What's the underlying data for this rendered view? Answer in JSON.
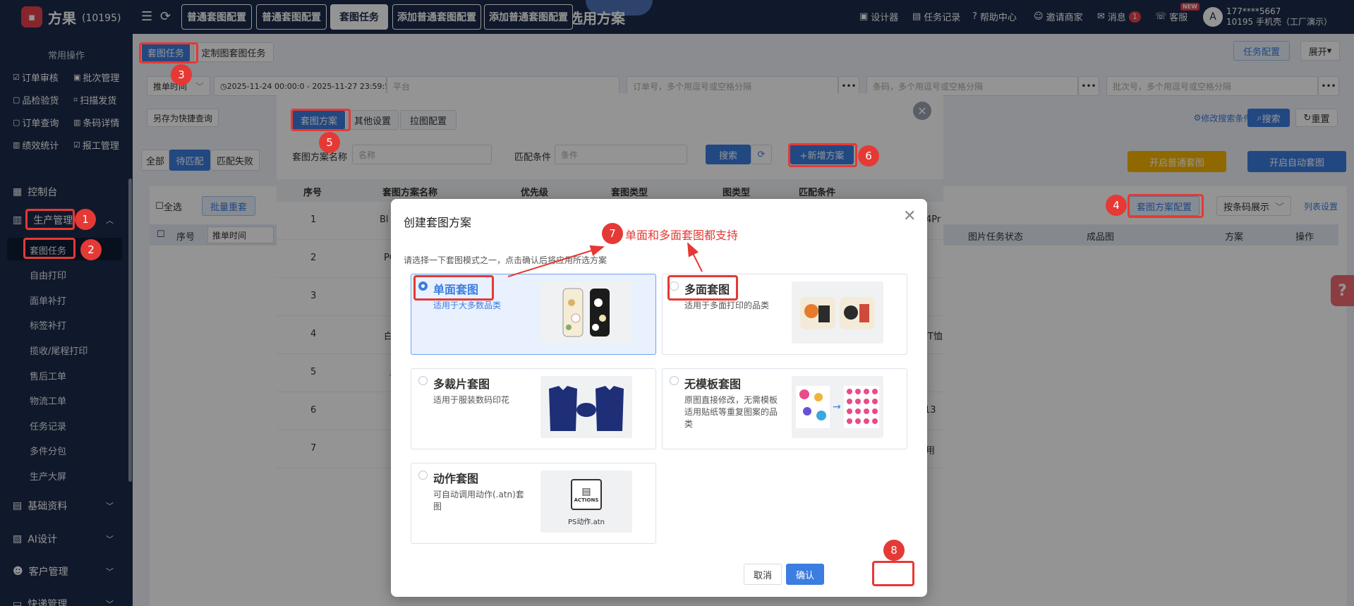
{
  "brand": {
    "name": "方果",
    "id": "(10195)"
  },
  "top_tabs": [
    "普通套图配置",
    "普通套图配置",
    "套图任务",
    "添加普通套图配置",
    "添加普通套图配置"
  ],
  "page_title": "选用方案",
  "top_links": {
    "designer": "设计器",
    "task_log": "任务记录",
    "help": "帮助中心",
    "invite": "邀请商家",
    "message": "消息",
    "message_count": "1",
    "service": "客服",
    "new": "NEW"
  },
  "user": {
    "phone": "177****5667",
    "name": "10195 手机壳（工厂演示）"
  },
  "sidebar": {
    "quick_title": "常用操作",
    "quick_ops": [
      "订单审核",
      "批次管理",
      "品检验货",
      "扫描发货",
      "订单查询",
      "条码详情",
      "绩效统计",
      "报工管理"
    ],
    "console": "控制台",
    "production": "生产管理",
    "sub_items": [
      "套图任务",
      "自由打印",
      "面单补打",
      "标签补打",
      "揽收/尾程打印",
      "售后工单",
      "物流工单",
      "任务记录",
      "多件分包",
      "生产大屏"
    ],
    "basic": "基础资料",
    "ai": "AI设计",
    "customer": "客户管理",
    "express": "快递管理"
  },
  "tabs": {
    "task": "套图任务",
    "custom": "定制图套图任务"
  },
  "right_btns": {
    "config": "任务配置",
    "expand": "展开"
  },
  "filters": {
    "time_type": "推单时间",
    "date_range": "2025-11-24 00:00:0 - 2025-11-27 23:59:5",
    "platform": "平台",
    "order": "订单号，多个用逗号或空格分隔",
    "barcode": "条码，多个用逗号或空格分隔",
    "batch": "批次号，多个用逗号或空格分隔",
    "more": "•••",
    "save_quick": "另存为快捷查询",
    "edit_conditions": "修改搜索条件",
    "search": "搜索",
    "reset": "重置"
  },
  "status_tabs": [
    "全部",
    "待匹配",
    "匹配失败"
  ],
  "actions": {
    "start_normal": "开启普通套图",
    "start_auto": "开启自动套图",
    "select_all": "全选",
    "batch_redo": "批量重套",
    "scheme_config": "套图方案配置",
    "display_by": "按条码展示",
    "list_settings": "列表设置"
  },
  "main_columns": {
    "index": "序号",
    "push_time": "推单时间",
    "status": "图片任务状态",
    "product": "成品图",
    "scheme": "方案",
    "ops": "操作"
  },
  "mid_modal": {
    "tabs": [
      "套图方案",
      "其他设置",
      "拉图配置"
    ],
    "name_label": "套图方案名称",
    "name_placeholder": "名称",
    "match_label": "匹配条件",
    "match_placeholder": "条件",
    "search": "搜索",
    "add": "+新增方案",
    "columns": [
      "序号",
      "套图方案名称",
      "优先级",
      "套图类型",
      "图类型",
      "匹配条件"
    ],
    "rows": [
      {
        "index": "1",
        "name": "Bl",
        "right": "4Pr"
      },
      {
        "index": "2",
        "name": "PC",
        "right": ""
      },
      {
        "index": "3",
        "name": "",
        "right": ""
      },
      {
        "index": "4",
        "name": "白",
        "right": "七T恤"
      },
      {
        "index": "5",
        "name": "手",
        "right": ""
      },
      {
        "index": "6",
        "name": "",
        "right": "13"
      },
      {
        "index": "7",
        "name": "",
        "right": "用"
      }
    ]
  },
  "dialog": {
    "title": "创建套图方案",
    "desc": "请选择一下套图模式之一，点击确认后将应用所选方案",
    "options": [
      {
        "title": "单面套图",
        "desc": "适用于大多数品类"
      },
      {
        "title": "多面套图",
        "desc": "适用于多面打印的品类"
      },
      {
        "title": "多裁片套图",
        "desc": "适用于服装数码印花"
      },
      {
        "title": "无模板套图",
        "desc": "原图直接修改，无需模板适用贴纸等重复图案的品类"
      },
      {
        "title": "动作套图",
        "desc": "可自动调用动作(.atn)套图"
      }
    ],
    "actions_label": "ACTIONS",
    "atn_label": "PS动作.atn",
    "cancel": "取消",
    "confirm": "确认"
  },
  "annotation": "单面和多面套图都支持",
  "step_numbers": [
    "1",
    "2",
    "3",
    "4",
    "5",
    "6",
    "7",
    "8"
  ],
  "colors": {
    "nav": "#1d2b4a",
    "primary": "#3c7de0",
    "annotation": "#e53935",
    "warning": "#f7b500"
  }
}
